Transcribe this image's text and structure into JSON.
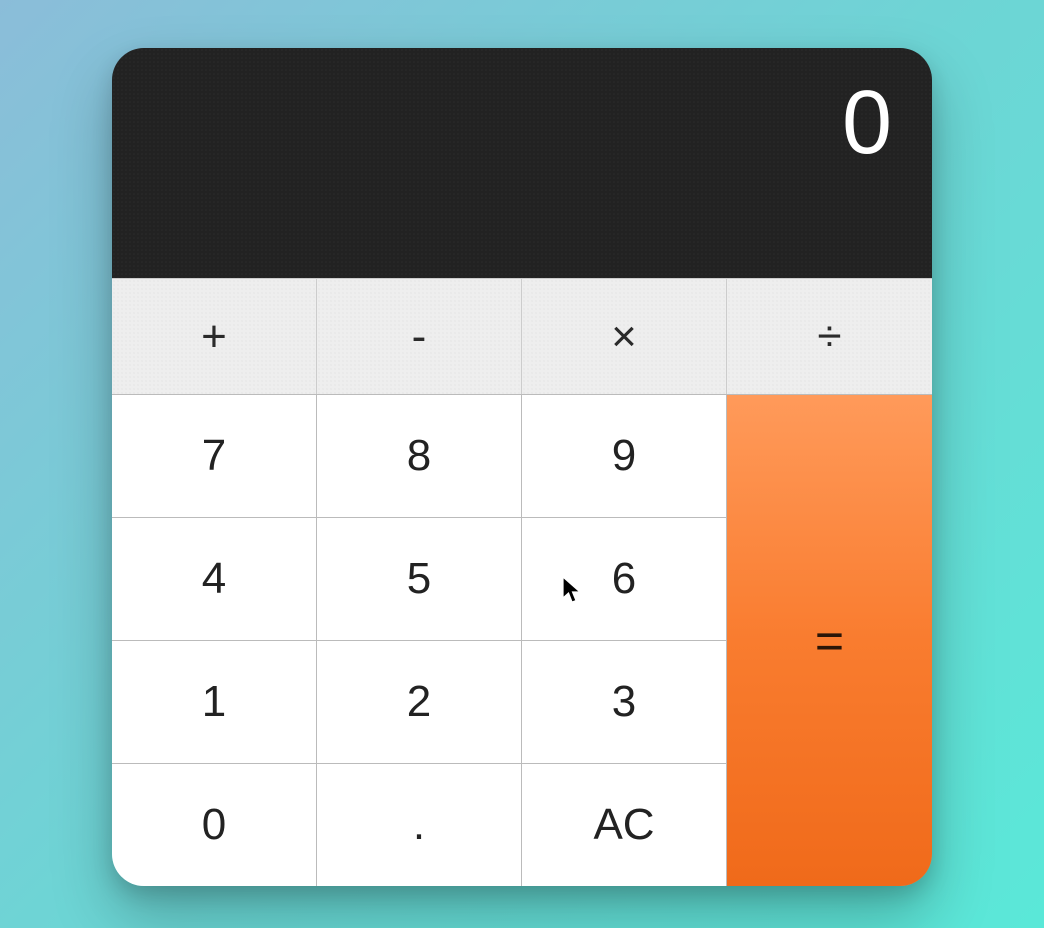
{
  "display": {
    "value": "0"
  },
  "operators": {
    "add": "+",
    "subtract": "-",
    "multiply": "×",
    "divide": "÷"
  },
  "numpad": {
    "seven": "7",
    "eight": "8",
    "nine": "9",
    "four": "4",
    "five": "5",
    "six": "6",
    "one": "1",
    "two": "2",
    "three": "3",
    "zero": "0",
    "decimal": ".",
    "clear": "AC"
  },
  "equals": "=",
  "colors": {
    "accent": "#f97c2f",
    "display_bg": "#222222",
    "op_bg": "#eeeeee",
    "num_bg": "#ffffff"
  }
}
